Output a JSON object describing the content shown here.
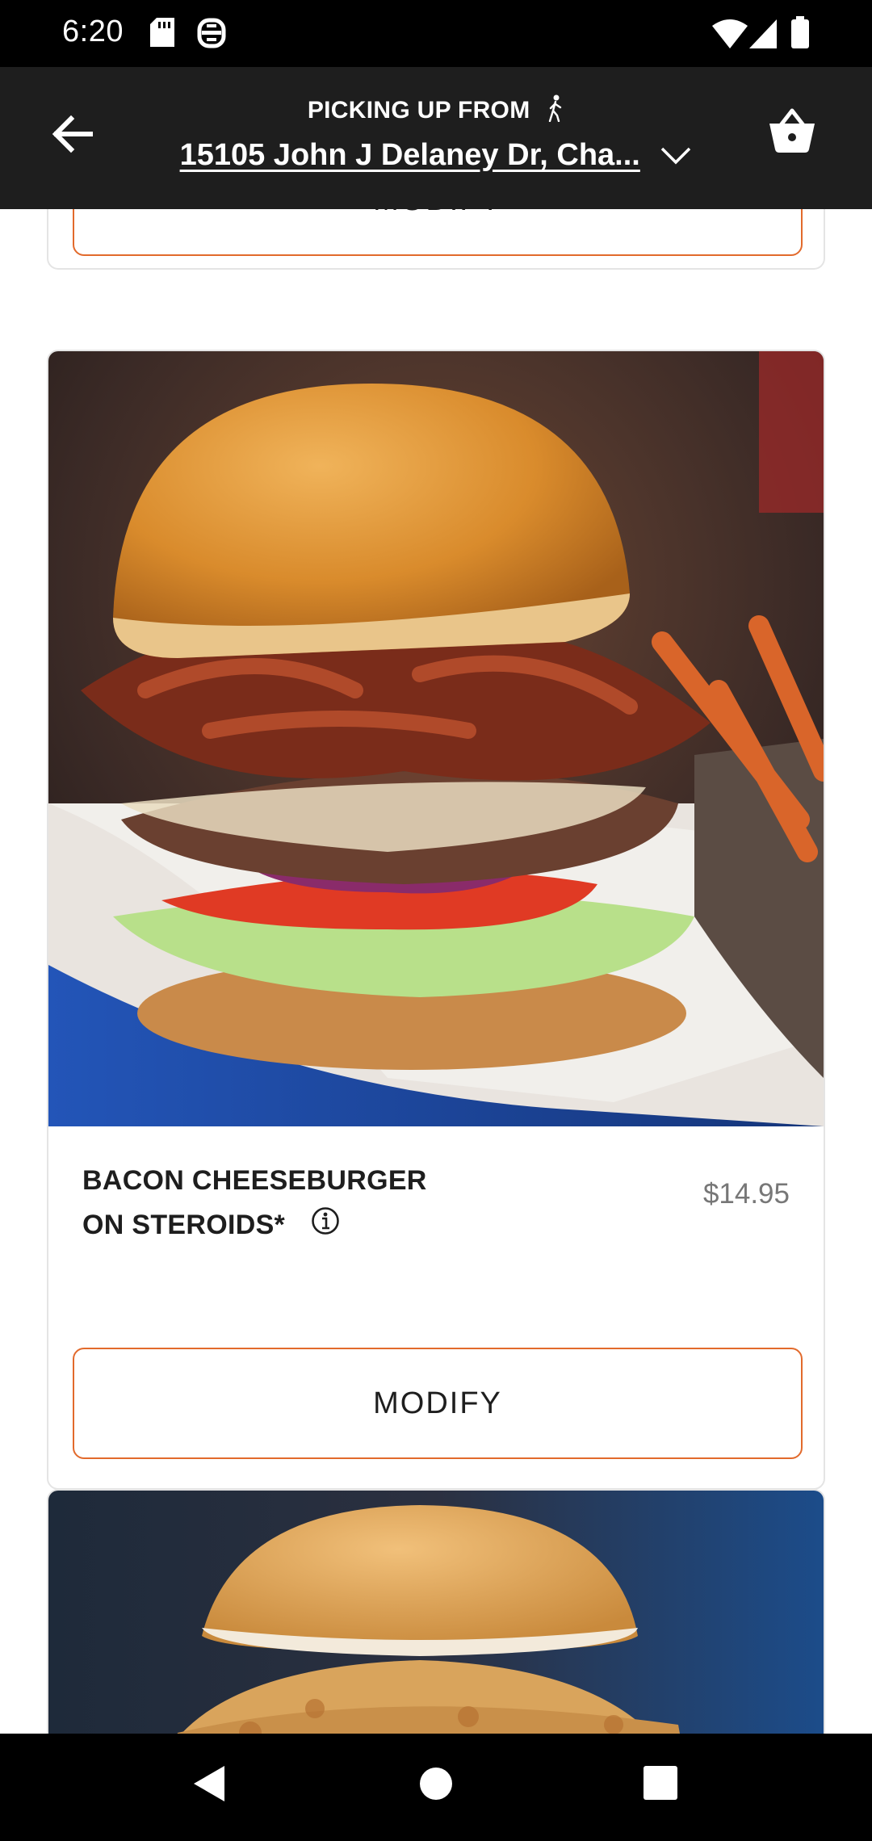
{
  "status_bar": {
    "time": "6:20"
  },
  "header": {
    "pickup_label": "PICKING UP FROM",
    "address": "15105 John J Delaney Dr, Cha..."
  },
  "cards": {
    "prev": {
      "modify_label": "MODIFY"
    },
    "item": {
      "name_line1": "BACON CHEESEBURGER",
      "name_line2": "ON STEROIDS*",
      "price": "$14.95",
      "modify_label": "MODIFY"
    }
  },
  "colors": {
    "accent": "#e26a2c",
    "header_bg": "#1e1e1e",
    "status_bg": "#000000"
  },
  "icons": [
    "back-arrow-icon",
    "walking-person-icon",
    "chevron-down-icon",
    "basket-icon",
    "info-icon",
    "sd-card-icon",
    "data-saver-icon",
    "wifi-icon",
    "signal-icon",
    "battery-icon",
    "nav-back-icon",
    "nav-home-icon",
    "nav-recents-icon"
  ]
}
